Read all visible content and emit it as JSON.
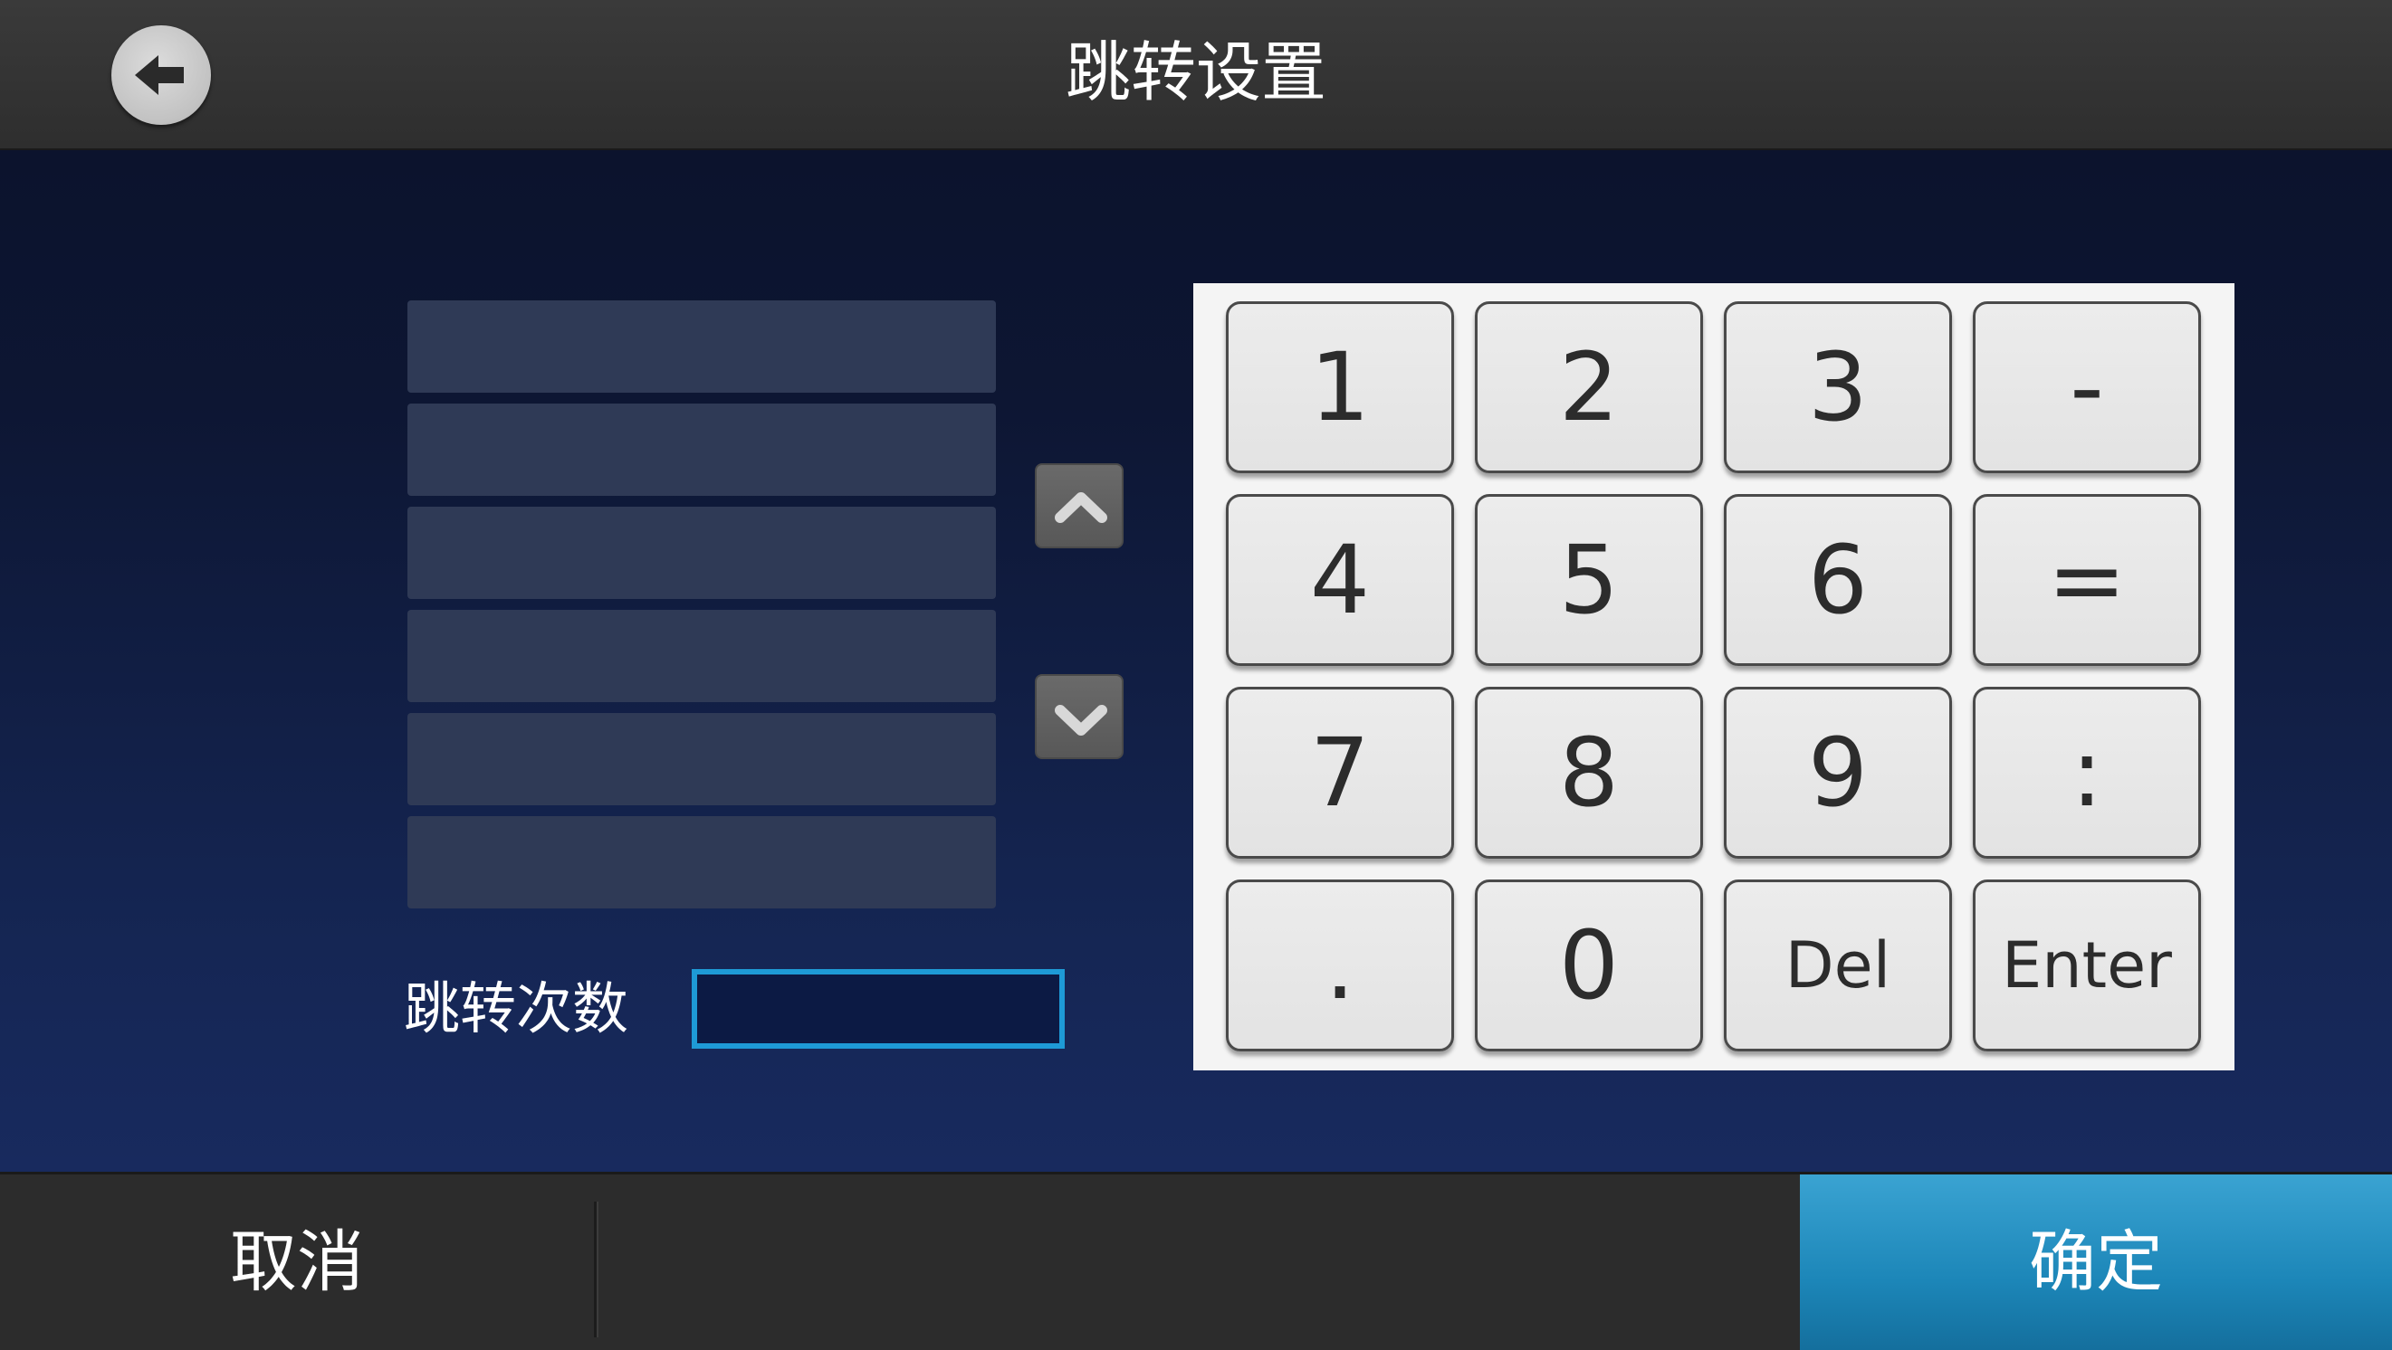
{
  "header": {
    "title": "跳转设置",
    "back_icon": "arrow-left-icon"
  },
  "list": {
    "items": [
      "",
      "",
      "",
      "",
      "",
      ""
    ],
    "scroll_up_icon": "chevron-up-icon",
    "scroll_down_icon": "chevron-down-icon"
  },
  "jump_count": {
    "label": "跳转次数",
    "value": ""
  },
  "keypad": {
    "keys": [
      "1",
      "2",
      "3",
      "-",
      "4",
      "5",
      "6",
      "=",
      "7",
      "8",
      "9",
      ":",
      ".",
      "0",
      "Del",
      "Enter"
    ]
  },
  "footer": {
    "cancel_label": "取消",
    "confirm_label": "确定"
  },
  "colors": {
    "accent": "#1e9ad6",
    "confirm": "#1c86b8",
    "bar": "#2e2e2e"
  }
}
